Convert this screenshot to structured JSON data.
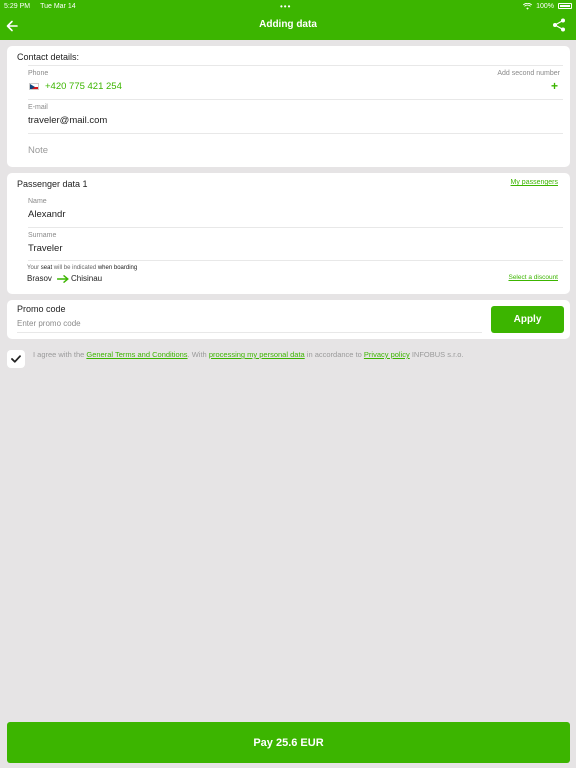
{
  "status_bar": {
    "time": "5:29 PM",
    "date": "Tue Mar 14",
    "dots": "•••",
    "battery": "100%"
  },
  "nav": {
    "title": "Adding data"
  },
  "contact": {
    "title": "Contact details:",
    "phone_label": "Phone",
    "add_second": "Add second number",
    "phone_value": "+420 775 421 254",
    "plus": "+",
    "email_label": "E-mail",
    "email_value": "traveler@mail.com",
    "note_placeholder": "Note"
  },
  "passenger": {
    "title": "Passenger data 1",
    "my_passengers": "My passengers",
    "name_label": "Name",
    "name_value": "Alexandr",
    "surname_label": "Surname",
    "surname_value": "Traveler",
    "seat_note_pre": "Your ",
    "seat_note_bold": "seat",
    "seat_note_mid": " will be indicated ",
    "seat_note_end": "when boarding",
    "from": "Brasov",
    "to": "Chisinau",
    "discount": "Select a discount"
  },
  "promo": {
    "title": "Promo code",
    "placeholder": "Enter promo code",
    "apply": "Apply"
  },
  "terms": {
    "t1": "I agree with the ",
    "l1": "General Terms and Conditions",
    "t2": ". With ",
    "l2": "processing my personal data",
    "t3": " in accordance to ",
    "l3": "Privacy policy",
    "t4": " INFOBUS s.r.o."
  },
  "pay": {
    "label": "Pay 25.6 EUR"
  },
  "colors": {
    "accent": "#3cb500",
    "background": "#e6e4e5"
  }
}
